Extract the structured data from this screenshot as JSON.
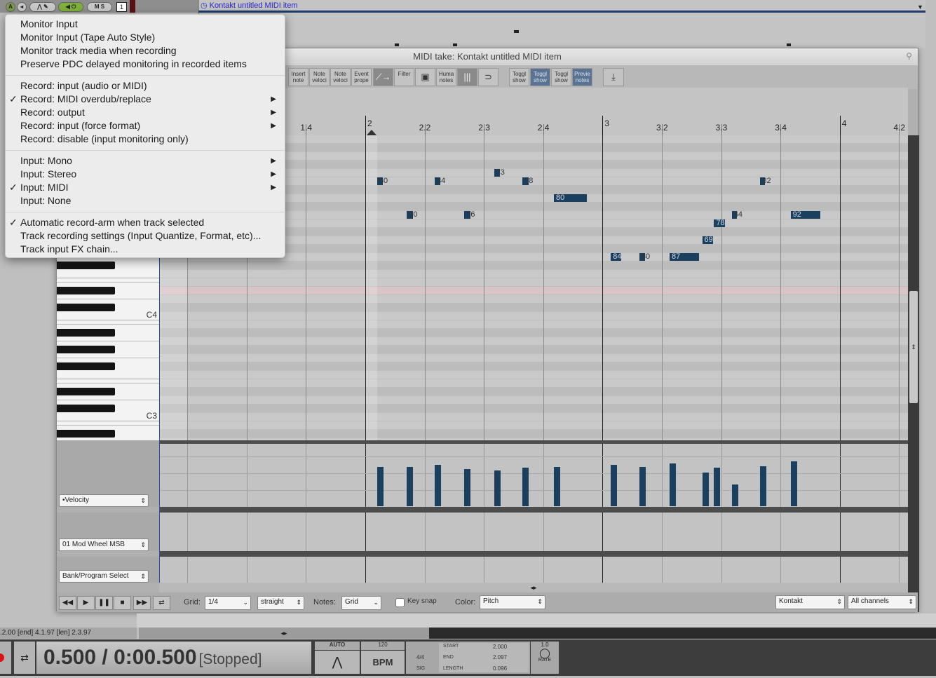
{
  "track": {
    "number": "1",
    "buttons": [
      "A",
      "M",
      "S"
    ],
    "item_title": "Kontakt untitled MIDI item"
  },
  "editor": {
    "title": "MIDI take: Kontakt untitled MIDI item",
    "toolbar": [
      {
        "label": "Insert note",
        "state": "off"
      },
      {
        "label": "Note veloci",
        "state": "off"
      },
      {
        "label": "Note veloci",
        "state": "off"
      },
      {
        "label": "Event prope",
        "state": "off"
      },
      {
        "label": "",
        "icon": "ramp-icon",
        "state": "dark"
      },
      {
        "label": "Filter",
        "state": "off"
      },
      {
        "label": "",
        "icon": "grid-window-icon",
        "state": "off"
      },
      {
        "label": "Huma notes",
        "state": "off"
      },
      {
        "label": "",
        "icon": "bars-icon",
        "state": "dark"
      },
      {
        "label": "",
        "icon": "loop-magnet-icon",
        "state": "off"
      },
      {
        "label": "Toggl show",
        "state": "off"
      },
      {
        "label": "Toggl show",
        "state": "on"
      },
      {
        "label": "Toggl show",
        "state": "off"
      },
      {
        "label": "Previe notes",
        "state": "on"
      },
      {
        "label": "",
        "icon": "download-icon",
        "state": "off"
      }
    ],
    "ruler": [
      {
        "label": "1.4",
        "qn": 3
      },
      {
        "label": "2",
        "qn": 4,
        "major": true
      },
      {
        "label": "2.2",
        "qn": 5
      },
      {
        "label": "2.3",
        "qn": 6
      },
      {
        "label": "2.4",
        "qn": 7
      },
      {
        "label": "3",
        "qn": 8,
        "major": true
      },
      {
        "label": "3.2",
        "qn": 9
      },
      {
        "label": "3.3",
        "qn": 10
      },
      {
        "label": "3.4",
        "qn": 11
      },
      {
        "label": "4",
        "qn": 12,
        "major": true
      },
      {
        "label": "4.2",
        "qn": 13
      }
    ],
    "key_labels": [
      {
        "label": "C4",
        "pitch": 60
      },
      {
        "label": "C3",
        "pitch": 48
      }
    ],
    "highlight_pitch": 63,
    "notes": [
      {
        "start": 4.2,
        "len": 0.1,
        "pitch": 76,
        "vel": 80
      },
      {
        "start": 5.17,
        "len": 0.1,
        "pitch": 76,
        "vel": 84
      },
      {
        "start": 6.17,
        "len": 0.1,
        "pitch": 77,
        "vel": 73
      },
      {
        "start": 6.65,
        "len": 0.1,
        "pitch": 76,
        "vel": 78
      },
      {
        "start": 7.18,
        "len": 0.55,
        "pitch": 74,
        "vel": 80
      },
      {
        "start": 4.7,
        "len": 0.1,
        "pitch": 72,
        "vel": 80
      },
      {
        "start": 5.67,
        "len": 0.1,
        "pitch": 72,
        "vel": 76
      },
      {
        "start": 8.14,
        "len": 0.17,
        "pitch": 67,
        "vel": 84
      },
      {
        "start": 8.62,
        "len": 0.1,
        "pitch": 67,
        "vel": 80
      },
      {
        "start": 9.13,
        "len": 0.5,
        "pitch": 67,
        "vel": 87
      },
      {
        "start": 9.68,
        "len": 0.18,
        "pitch": 69,
        "vel": 69
      },
      {
        "start": 9.88,
        "len": 0.18,
        "pitch": 71,
        "vel": 78
      },
      {
        "start": 10.18,
        "len": 0.08,
        "pitch": 72,
        "vel": 44
      },
      {
        "start": 10.66,
        "len": 0.08,
        "pitch": 76,
        "vel": 82
      },
      {
        "start": 11.17,
        "len": 0.5,
        "pitch": 72,
        "vel": 92
      }
    ],
    "cc_lanes": [
      {
        "label": "•Velocity"
      },
      {
        "label": "01 Mod Wheel MSB"
      },
      {
        "label": "Bank/Program Select"
      }
    ],
    "bottom": {
      "grid_label": "Grid:",
      "grid_value": "1/4",
      "swing": "straight",
      "notes_label": "Notes:",
      "notes_value": "Grid",
      "key_snap": "Key snap",
      "key_snap_checked": false,
      "color_label": "Color:",
      "color_value": "Pitch",
      "channel_target": "Kontakt",
      "channels": "All channels"
    },
    "note_color": "#1b3f5e"
  },
  "menu": {
    "groups": [
      [
        {
          "label": "Monitor Input"
        },
        {
          "label": "Monitor Input (Tape Auto Style)"
        },
        {
          "label": "Monitor track media when recording"
        },
        {
          "label": "Preserve PDC delayed monitoring in recorded items"
        }
      ],
      [
        {
          "label": "Record: input (audio or MIDI)"
        },
        {
          "label": "Record: MIDI overdub/replace",
          "checked": true,
          "submenu": true
        },
        {
          "label": "Record: output",
          "submenu": true
        },
        {
          "label": "Record: input (force format)",
          "submenu": true
        },
        {
          "label": "Record: disable (input monitoring only)"
        }
      ],
      [
        {
          "label": "Input: Mono",
          "submenu": true
        },
        {
          "label": "Input: Stereo",
          "submenu": true
        },
        {
          "label": "Input: MIDI",
          "checked": true,
          "submenu": true
        },
        {
          "label": "Input: None"
        }
      ],
      [
        {
          "label": "Automatic record-arm when track selected",
          "checked": true
        },
        {
          "label": "Track recording settings (Input Quantize, Format, etc)..."
        },
        {
          "label": "Track input FX chain..."
        }
      ]
    ]
  },
  "status": ".2.00 [end] 4.1.97 [len] 2.3.97",
  "transport": {
    "position": "0.500 / 0:00.500",
    "state": "[Stopped]",
    "auto": "AUTO",
    "bpm_value": "120",
    "bpm": "BPM",
    "sig_value": "4/4",
    "sig": "SIG",
    "start_label": "START",
    "start": "2.000",
    "end_label": "END",
    "end": "2.097",
    "length_label": "LENGTH",
    "length": "0.096",
    "rate_value": "1.0",
    "rate": "RATE"
  }
}
